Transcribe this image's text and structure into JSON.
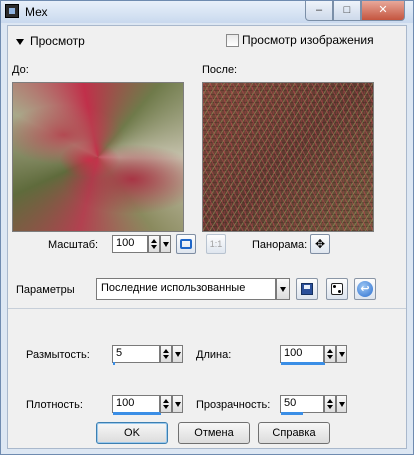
{
  "window": {
    "title": "Мех",
    "minimize_glyph": "–",
    "maximize_glyph": "□",
    "close_glyph": "✕"
  },
  "preview_section": {
    "toggle_label": "Просмотр",
    "show_image_label": "Просмотр изображения",
    "show_image_checked": false
  },
  "previews": {
    "before_label": "До:",
    "after_label": "После:"
  },
  "zoom": {
    "label": "Масштаб:",
    "value": "100",
    "fit_icon": "fit-window-icon",
    "actual_size_label": "1:1",
    "actual_size_enabled": false,
    "pan_label": "Панорама:",
    "pan_icon": "move-arrows-icon",
    "pan_glyph": "✥"
  },
  "presets": {
    "label": "Параметры",
    "selected": "Последние использованные",
    "save_icon": "save-icon",
    "random_icon": "dice-icon",
    "reset_icon": "reset-icon",
    "reset_glyph": "↩"
  },
  "settings": {
    "blur": {
      "label": "Размытость:",
      "value": "5",
      "level": 0.05
    },
    "length": {
      "label": "Длина:",
      "value": "100",
      "level": 1.0
    },
    "density": {
      "label": "Плотность:",
      "value": "100",
      "level": 1.0
    },
    "opacity": {
      "label": "Прозрачность:",
      "value": "50",
      "level": 0.5
    }
  },
  "buttons": {
    "ok": "OK",
    "cancel": "Отмена",
    "help": "Справка"
  },
  "colors": {
    "accent": "#3a8ee6",
    "frame": "#dde7f3",
    "close": "#c4553f"
  }
}
